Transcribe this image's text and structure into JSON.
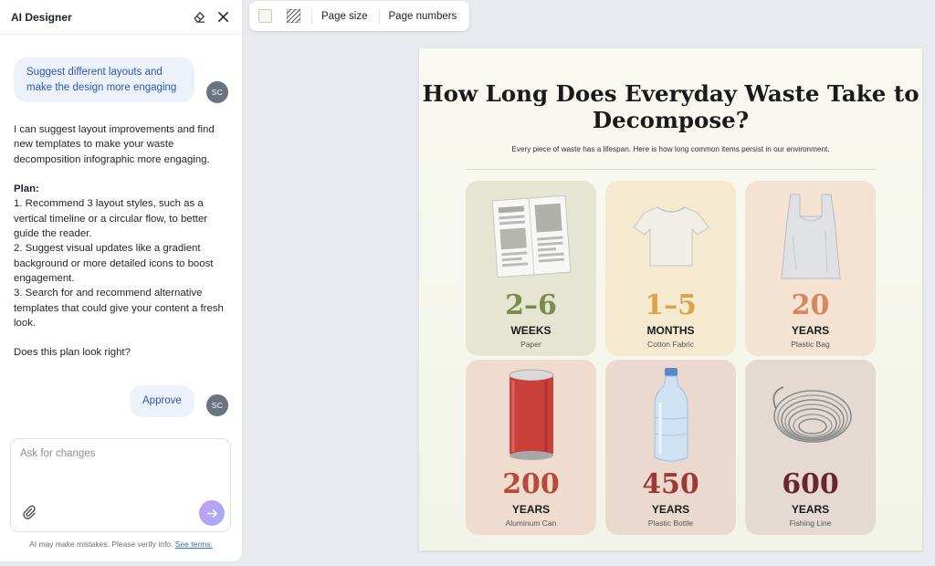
{
  "sidebar": {
    "title": "AI Designer",
    "messages": {
      "user1": "Suggest different layouts and make the design more engaging",
      "user1_avatar": "SC",
      "ai_intro": "I can suggest layout improvements and find new templates to make your waste decomposition infographic more engaging.",
      "plan_label": "Plan:",
      "plan_1": "1. Recommend 3 layout styles, such as a vertical timeline or a circular flow, to better guide the reader.",
      "plan_2": "2. Suggest visual updates like a gradient background or more detailed icons to boost engagement.",
      "plan_3": "3. Search for and recommend alternative templates that could give your content a fresh look.",
      "question": "Does this plan look right?",
      "user2": "Approve",
      "user2_avatar": "SC"
    },
    "input_placeholder": "Ask for changes",
    "disclaimer": "AI may make mistakes. Please verify info.",
    "disclaimer_link": "See terms."
  },
  "toolbar": {
    "page_size": "Page size",
    "page_numbers": "Page numbers"
  },
  "infographic": {
    "title": "How Long Does Everyday Waste Take to Decompose?",
    "subtitle": "Every piece of waste has a lifespan. Here is how long common items persist in our environment.",
    "items": [
      {
        "number": "2–6",
        "unit": "WEEKS",
        "label": "Paper",
        "color": "#7a8c4a",
        "bg": "#e4e6d2",
        "icon": "newspaper-icon"
      },
      {
        "number": "1–5",
        "unit": "MONTHS",
        "label": "Cotton Fabric",
        "color": "#dca447",
        "bg": "#f5ead0",
        "icon": "tshirt-icon"
      },
      {
        "number": "20",
        "unit": "YEARS",
        "label": "Plastic Bag",
        "color": "#d8865a",
        "bg": "#f4e2d2",
        "icon": "plastic-bag-icon"
      },
      {
        "number": "200",
        "unit": "YEARS",
        "label": "Aluminum Can",
        "color": "#b84a3a",
        "bg": "#f0dccf",
        "icon": "soda-can-icon"
      },
      {
        "number": "450",
        "unit": "YEARS",
        "label": "Plastic Bottle",
        "color": "#9c3a32",
        "bg": "#ebd9cf",
        "icon": "water-bottle-icon"
      },
      {
        "number": "600",
        "unit": "YEARS",
        "label": "Fishing Line",
        "color": "#6b2530",
        "bg": "#e4dad3",
        "icon": "fishing-line-icon"
      }
    ]
  }
}
